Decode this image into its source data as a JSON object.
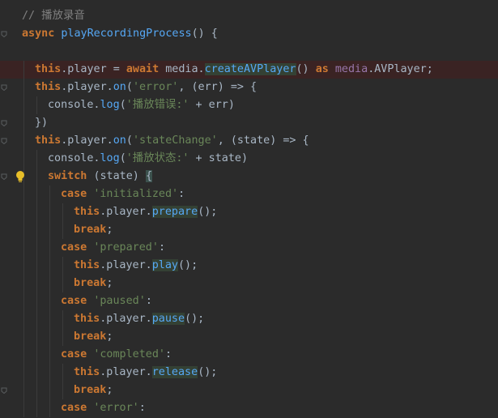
{
  "editor": {
    "lines": [
      {
        "indent": 0,
        "tokens": [
          {
            "t": "// 播放录音",
            "c": "cmt"
          }
        ]
      },
      {
        "indent": 0,
        "tokens": [
          {
            "t": "async ",
            "c": "kw"
          },
          {
            "t": "playRecordingProcess",
            "c": "fnb"
          },
          {
            "t": "() {",
            "c": "paren"
          }
        ]
      },
      {
        "indent": 0,
        "tokens": []
      },
      {
        "indent": 1,
        "highlight": true,
        "tokens": [
          {
            "t": "this",
            "c": "kw"
          },
          {
            "t": ".player = ",
            "c": "plain"
          },
          {
            "t": "await ",
            "c": "kw"
          },
          {
            "t": "media.",
            "c": "plain"
          },
          {
            "t": "createAVPlayer",
            "c": "hl-method"
          },
          {
            "t": "() ",
            "c": "plain"
          },
          {
            "t": "as ",
            "c": "kw"
          },
          {
            "t": "media",
            "c": "purple"
          },
          {
            "t": ".AVPlayer;",
            "c": "plain"
          }
        ]
      },
      {
        "indent": 1,
        "tokens": [
          {
            "t": "this",
            "c": "kw"
          },
          {
            "t": ".player.",
            "c": "plain"
          },
          {
            "t": "on",
            "c": "meth"
          },
          {
            "t": "(",
            "c": "plain"
          },
          {
            "t": "'error'",
            "c": "str"
          },
          {
            "t": ", (err) => {",
            "c": "plain"
          }
        ]
      },
      {
        "indent": 2,
        "tokens": [
          {
            "t": "console.",
            "c": "plain"
          },
          {
            "t": "log",
            "c": "meth"
          },
          {
            "t": "(",
            "c": "plain"
          },
          {
            "t": "'播放错误:'",
            "c": "str"
          },
          {
            "t": " + err)",
            "c": "plain"
          }
        ]
      },
      {
        "indent": 1,
        "tokens": [
          {
            "t": "})",
            "c": "plain"
          }
        ]
      },
      {
        "indent": 1,
        "tokens": [
          {
            "t": "this",
            "c": "kw"
          },
          {
            "t": ".player.",
            "c": "plain"
          },
          {
            "t": "on",
            "c": "meth"
          },
          {
            "t": "(",
            "c": "plain"
          },
          {
            "t": "'stateChange'",
            "c": "str"
          },
          {
            "t": ", (state) => {",
            "c": "plain"
          }
        ]
      },
      {
        "indent": 2,
        "tokens": [
          {
            "t": "console.",
            "c": "plain"
          },
          {
            "t": "log",
            "c": "meth"
          },
          {
            "t": "(",
            "c": "plain"
          },
          {
            "t": "'播放状态:'",
            "c": "str"
          },
          {
            "t": " + state)",
            "c": "plain"
          }
        ]
      },
      {
        "indent": 2,
        "tokens": [
          {
            "t": "switch ",
            "c": "kw"
          },
          {
            "t": "(state) ",
            "c": "plain"
          },
          {
            "t": "{",
            "c": "bracket-match"
          }
        ]
      },
      {
        "indent": 3,
        "tokens": [
          {
            "t": "case ",
            "c": "kw"
          },
          {
            "t": "'initialized'",
            "c": "str"
          },
          {
            "t": ":",
            "c": "plain"
          }
        ]
      },
      {
        "indent": 4,
        "tokens": [
          {
            "t": "this",
            "c": "kw"
          },
          {
            "t": ".player.",
            "c": "plain"
          },
          {
            "t": "prepare",
            "c": "hl-method"
          },
          {
            "t": "();",
            "c": "plain"
          }
        ]
      },
      {
        "indent": 4,
        "tokens": [
          {
            "t": "break",
            "c": "kw"
          },
          {
            "t": ";",
            "c": "plain"
          }
        ]
      },
      {
        "indent": 3,
        "tokens": [
          {
            "t": "case ",
            "c": "kw"
          },
          {
            "t": "'prepared'",
            "c": "str"
          },
          {
            "t": ":",
            "c": "plain"
          }
        ]
      },
      {
        "indent": 4,
        "tokens": [
          {
            "t": "this",
            "c": "kw"
          },
          {
            "t": ".player.",
            "c": "plain"
          },
          {
            "t": "play",
            "c": "hl-method"
          },
          {
            "t": "();",
            "c": "plain"
          }
        ]
      },
      {
        "indent": 4,
        "tokens": [
          {
            "t": "break",
            "c": "kw"
          },
          {
            "t": ";",
            "c": "plain"
          }
        ]
      },
      {
        "indent": 3,
        "tokens": [
          {
            "t": "case ",
            "c": "kw"
          },
          {
            "t": "'paused'",
            "c": "str"
          },
          {
            "t": ":",
            "c": "plain"
          }
        ]
      },
      {
        "indent": 4,
        "tokens": [
          {
            "t": "this",
            "c": "kw"
          },
          {
            "t": ".player.",
            "c": "plain"
          },
          {
            "t": "pause",
            "c": "hl-method"
          },
          {
            "t": "();",
            "c": "plain"
          }
        ]
      },
      {
        "indent": 4,
        "tokens": [
          {
            "t": "break",
            "c": "kw"
          },
          {
            "t": ";",
            "c": "plain"
          }
        ]
      },
      {
        "indent": 3,
        "tokens": [
          {
            "t": "case ",
            "c": "kw"
          },
          {
            "t": "'completed'",
            "c": "str"
          },
          {
            "t": ":",
            "c": "plain"
          }
        ]
      },
      {
        "indent": 4,
        "tokens": [
          {
            "t": "this",
            "c": "kw"
          },
          {
            "t": ".player.",
            "c": "plain"
          },
          {
            "t": "release",
            "c": "hl-method"
          },
          {
            "t": "();",
            "c": "plain"
          }
        ]
      },
      {
        "indent": 4,
        "tokens": [
          {
            "t": "break",
            "c": "kw"
          },
          {
            "t": ";",
            "c": "plain"
          }
        ]
      },
      {
        "indent": 3,
        "tokens": [
          {
            "t": "case ",
            "c": "kw"
          },
          {
            "t": "'error'",
            "c": "str"
          },
          {
            "t": ":",
            "c": "plain"
          }
        ]
      }
    ],
    "icons": {
      "bulb": "lightbulb-icon",
      "fold": "fold-marker-icon"
    },
    "colors": {
      "background": "#2b2b2b",
      "keyword": "#cc7832",
      "string": "#6a8759",
      "comment": "#808080",
      "method": "#56a8f5",
      "highlight_line": "#3a2323",
      "bulb": "#e8bf29"
    }
  }
}
